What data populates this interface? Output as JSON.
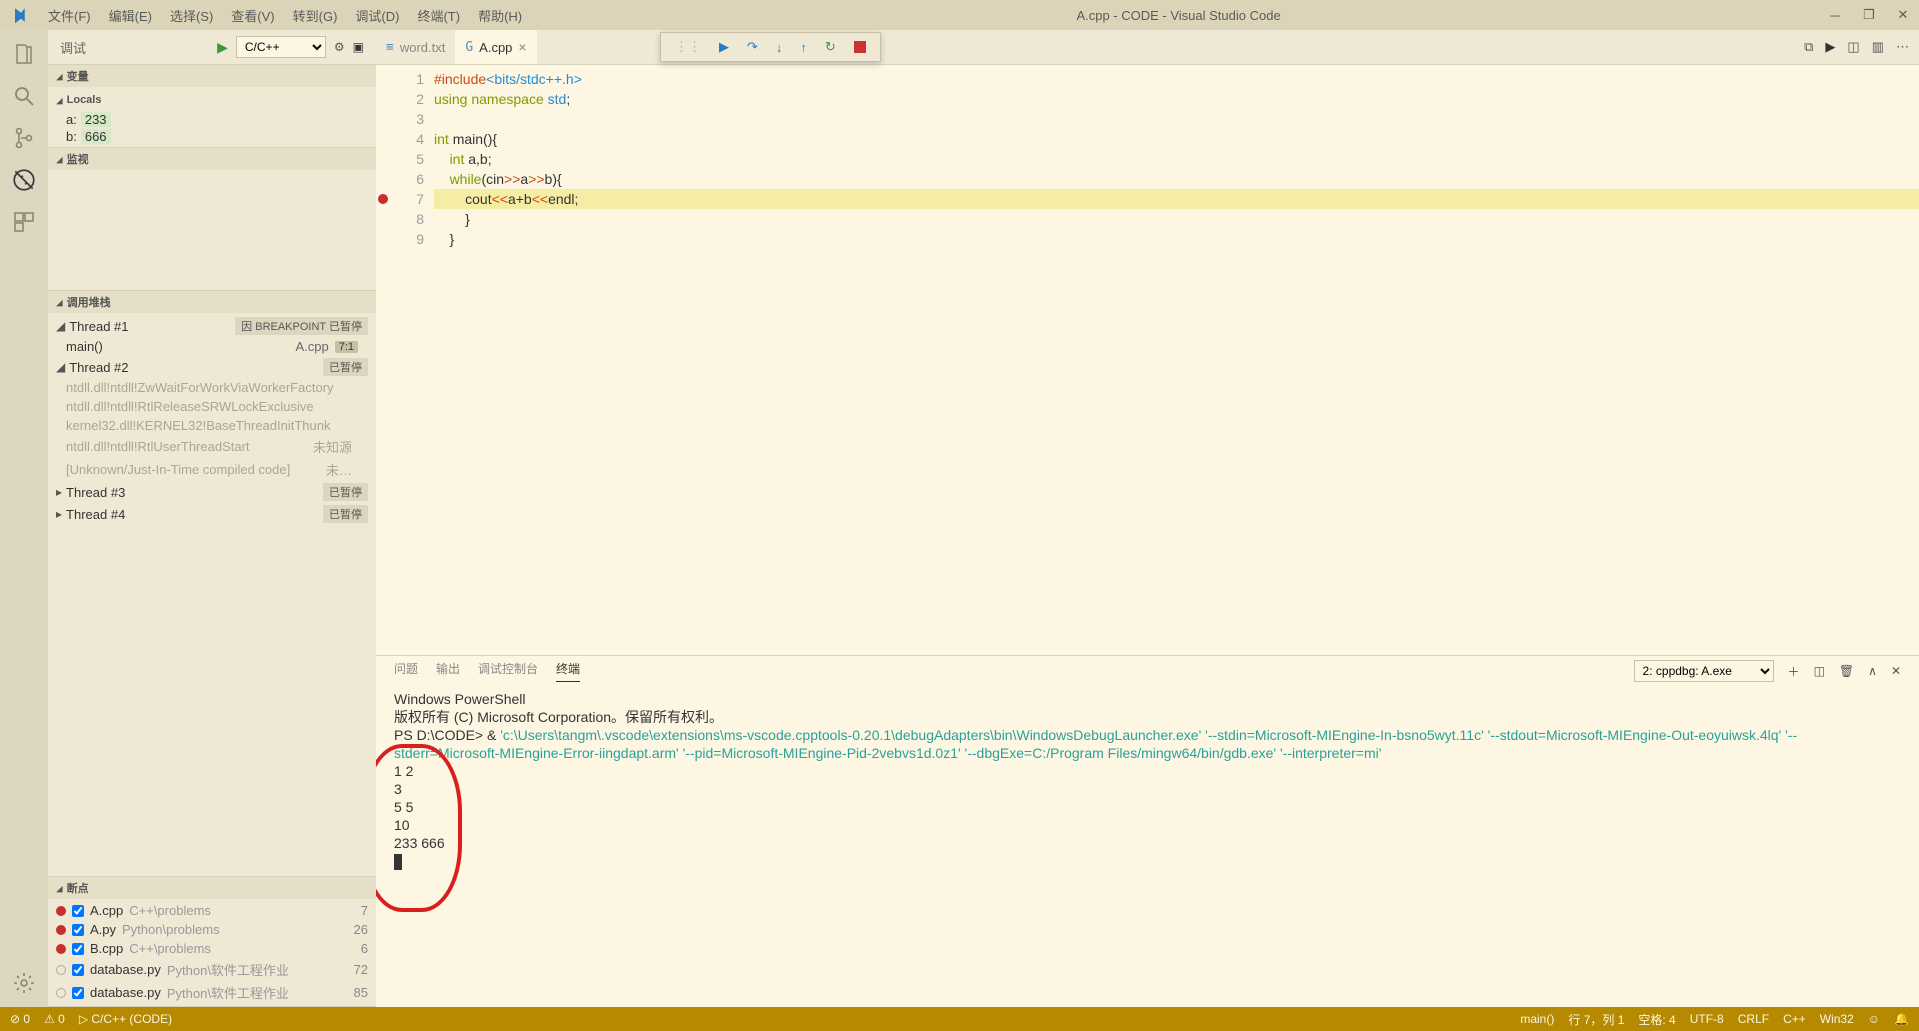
{
  "titlebar": {
    "menu": [
      "文件(F)",
      "编辑(E)",
      "选择(S)",
      "查看(V)",
      "转到(G)",
      "调试(D)",
      "终端(T)",
      "帮助(H)"
    ],
    "title": "A.cpp - CODE - Visual Studio Code"
  },
  "sidebar": {
    "header": {
      "title": "调试",
      "config": "C/C++"
    },
    "variables": {
      "title": "变量",
      "locals_label": "Locals",
      "items": [
        {
          "name": "a:",
          "value": "233"
        },
        {
          "name": "b:",
          "value": "666"
        }
      ]
    },
    "watch": {
      "title": "监视"
    },
    "callstack": {
      "title": "调用堆栈",
      "threads": [
        {
          "name": "Thread #1",
          "badge": "因 BREAKPOINT 已暂停",
          "expanded": true,
          "frames": [
            {
              "fn": "main()",
              "file": "A.cpp",
              "line": "7:1",
              "dim": false
            }
          ]
        },
        {
          "name": "Thread #2",
          "badge": "已暂停",
          "expanded": true,
          "frames": [
            {
              "fn": "ntdll.dll!ntdll!ZwWaitForWorkViaWorkerFactory",
              "file": "",
              "line": "",
              "dim": true
            },
            {
              "fn": "ntdll.dll!ntdll!RtlReleaseSRWLockExclusive",
              "file": "",
              "line": "",
              "dim": true
            },
            {
              "fn": "kernel32.dll!KERNEL32!BaseThreadInitThunk",
              "file": "",
              "line": "",
              "dim": true
            },
            {
              "fn": "ntdll.dll!ntdll!RtlUserThreadStart",
              "file": "未知源",
              "line": "",
              "dim": true
            },
            {
              "fn": "[Unknown/Just-In-Time compiled code]",
              "file": "未…",
              "line": "",
              "dim": true
            }
          ]
        },
        {
          "name": "Thread #3",
          "badge": "已暂停",
          "expanded": false,
          "frames": []
        },
        {
          "name": "Thread #4",
          "badge": "已暂停",
          "expanded": false,
          "frames": []
        }
      ]
    },
    "breakpoints": {
      "title": "断点",
      "items": [
        {
          "active": true,
          "checked": true,
          "name": "A.cpp",
          "path": "C++\\problems",
          "line": "7"
        },
        {
          "active": true,
          "checked": true,
          "name": "A.py",
          "path": "Python\\problems",
          "line": "26"
        },
        {
          "active": true,
          "checked": true,
          "name": "B.cpp",
          "path": "C++\\problems",
          "line": "6"
        },
        {
          "active": false,
          "checked": true,
          "name": "database.py",
          "path": "Python\\软件工程作业",
          "line": "72"
        },
        {
          "active": false,
          "checked": true,
          "name": "database.py",
          "path": "Python\\软件工程作业",
          "line": "85"
        }
      ]
    }
  },
  "editor": {
    "tabs": [
      {
        "icon": "≡",
        "label": "word.txt",
        "active": false
      },
      {
        "icon": "G",
        "label": "A.cpp",
        "active": true
      }
    ],
    "code": [
      {
        "n": "1",
        "html": "<span class='tk-preproc'>#include</span><span class='tk-ns'>&lt;bits/stdc++.h&gt;</span>"
      },
      {
        "n": "2",
        "html": "<span class='tk-keyword'>using</span> <span class='tk-keyword'>namespace</span> <span class='tk-ns'>std</span>;"
      },
      {
        "n": "3",
        "html": ""
      },
      {
        "n": "4",
        "html": "<span class='tk-keyword'>int</span> <span class='tk-func'>main</span>(){"
      },
      {
        "n": "5",
        "html": "    <span class='tk-keyword'>int</span> a,b;"
      },
      {
        "n": "6",
        "html": "    <span class='tk-keyword'>while</span>(cin<span class='tk-preproc'>&gt;&gt;</span>a<span class='tk-preproc'>&gt;&gt;</span>b){"
      },
      {
        "n": "7",
        "html": "        cout<span class='tk-preproc'>&lt;&lt;</span>a+b<span class='tk-preproc'>&lt;&lt;</span>endl;",
        "highlight": true,
        "bp": true
      },
      {
        "n": "8",
        "html": "        }"
      },
      {
        "n": "9",
        "html": "    }"
      }
    ]
  },
  "panel": {
    "tabs": [
      "问题",
      "输出",
      "调试控制台",
      "终端"
    ],
    "active_tab": "终端",
    "terminal_select": "2: cppdbg: A.exe",
    "lines": [
      {
        "plain": "Windows PowerShell"
      },
      {
        "plain": "版权所有 (C) Microsoft Corporation。保留所有权利。"
      },
      {
        "plain": ""
      },
      {
        "prefix": "PS D:\\CODE> & ",
        "cmd": "'c:\\Users\\tangm\\.vscode\\extensions\\ms-vscode.cpptools-0.20.1\\debugAdapters\\bin\\WindowsDebugLauncher.exe' '--stdin=Microsoft-MIEngine-In-bsno5wyt.11c' '--stdout=Microsoft-MIEngine-Out-eoyuiwsk.4lq' '--stderr=Microsoft-MIEngine-Error-iingdapt.arm' '--pid=Microsoft-MIEngine-Pid-2vebvs1d.0z1' '--dbgExe=C:/Program Files/mingw64/bin/gdb.exe' '--interpreter=mi'"
      },
      {
        "plain": "1 2"
      },
      {
        "plain": "3"
      },
      {
        "plain": "5 5"
      },
      {
        "plain": "10"
      },
      {
        "plain": "233 666"
      }
    ]
  },
  "statusbar": {
    "left": [
      {
        "icon": "⊘",
        "text": "0"
      },
      {
        "icon": "⚠",
        "text": "0"
      },
      {
        "icon": "▷",
        "text": "C/C++ (CODE)"
      }
    ],
    "right": [
      {
        "text": "main()"
      },
      {
        "text": "行 7，列 1"
      },
      {
        "text": "空格: 4"
      },
      {
        "text": "UTF-8"
      },
      {
        "text": "CRLF"
      },
      {
        "text": "C++"
      },
      {
        "text": "Win32"
      },
      {
        "icon": "☺",
        "text": ""
      },
      {
        "icon": "🔔",
        "text": ""
      }
    ]
  }
}
